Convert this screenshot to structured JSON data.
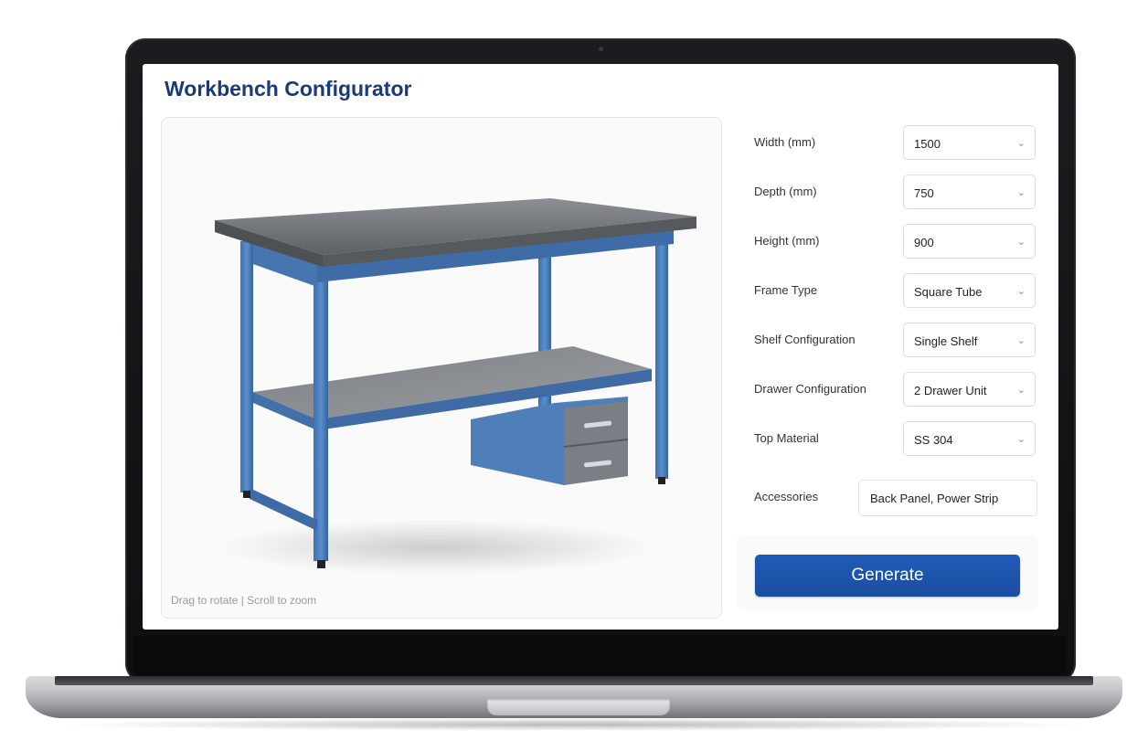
{
  "app": {
    "title": "Workbench Configurator"
  },
  "viewer": {
    "hint": "Drag to rotate | Scroll to zoom"
  },
  "config": {
    "fields": [
      {
        "label": "Width (mm)",
        "value": "1500"
      },
      {
        "label": "Depth (mm)",
        "value": "750"
      },
      {
        "label": "Height (mm)",
        "value": "900"
      },
      {
        "label": "Frame Type",
        "value": "Square Tube"
      },
      {
        "label": "Shelf Configuration",
        "value": "Single Shelf"
      },
      {
        "label": "Drawer Configuration",
        "value": "2 Drawer Unit"
      },
      {
        "label": "Top Material",
        "value": "SS 304"
      }
    ],
    "accessories": {
      "label": "Accessories",
      "value": "Back Panel, Power Strip"
    },
    "generate_label": "Generate"
  },
  "colors": {
    "title": "#1b3a7a",
    "frame_blue": "#4a7fbf",
    "button": "#1f5bb8"
  },
  "icons": {
    "select_chevron": "chevron-down-icon"
  }
}
